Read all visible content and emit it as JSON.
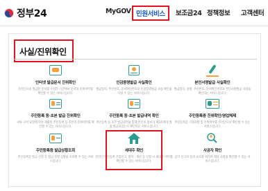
{
  "header": {
    "logo_text": "정부24",
    "nav": [
      {
        "label": "MyGOV",
        "active": false
      },
      {
        "label": "민원서비스",
        "active": true
      },
      {
        "label": "보조금24",
        "active": false
      },
      {
        "label": "정책정보",
        "active": false
      },
      {
        "label": "고객센터",
        "active": false
      }
    ]
  },
  "section": {
    "title": "사실/진위확인"
  },
  "cards": [
    {
      "title": "인터넷 발급문서 진위확인",
      "desc": "온라인으로 발급된 문서를 수령한 기관에서 문서의 진위여부를 확인할 수 있는 서비스입니다.",
      "icon": "document-check-icon"
    },
    {
      "title": "인감증명발급 사실확인",
      "desc": "발급일자, 주민번호, 문서확인번호로 인감증명발급 사실 확인을 하실 수 있는 서비스입니다.",
      "icon": "stamp-seal-icon"
    },
    {
      "title": "본인서명발급 사실확인",
      "desc": "발급일자, 성명, 주민번호, 문서확인번호로 본인서명발급 사실을 확인하는 서비스입니다.",
      "icon": "pen-signature-icon"
    },
    {
      "title": "주민등록 등·초본 발급 진위확인",
      "desc": "서류 구비 요청에 따라 제출된 주민등록 등·초본의 진위여부를 확인할 수 있는 서비스입니다.",
      "icon": "id-card-check-icon"
    },
    {
      "title": "주민등록 등·초본 발급내역 확인",
      "desc": "주민등록 등·초본 발급내역을 통해 본인의 정보가 제3자에게 열람·발급되었는지 확인하는 서비스입니다.",
      "icon": "id-card-history-icon"
    },
    {
      "title": "주민등록증 진위확인/영업체제",
      "desc": "주민등록증 기재사항 및 진위여부를 온라인으로 확인할 수 있는 서비스입니다.",
      "icon": "id-card-verify-icon"
    },
    {
      "title": "주민등록증 발급상황조회",
      "desc": "주민등록증 발급 신청 후 발급 진행 상황을 조회할 수 있는 서비스입니다.",
      "icon": "id-card-status-icon"
    },
    {
      "title": "세대주 확인",
      "desc": "온라인 주민등록 전입신고, 청약 · 재산 등 신청 시 세대주 여부를 확인할 수 있는 서비스입니다.",
      "icon": "house-icon"
    },
    {
      "title": "사공자 확인",
      "desc": "공익 신고자 등의 보호를 위하여 해당 사항을 확인할 수 있는 서비스입니다.",
      "icon": "person-search-icon"
    }
  ],
  "colors": {
    "accent": "#1a56c4",
    "highlight": "#e3101e",
    "icon_teal": "#2c9b8f",
    "icon_orange": "#f2a23a"
  }
}
